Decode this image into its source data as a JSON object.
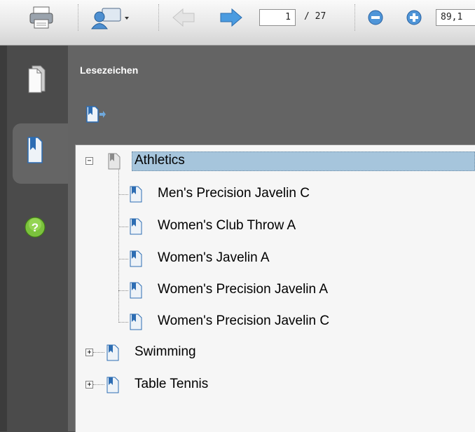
{
  "toolbar": {
    "page_current": "1",
    "page_total": "/ 27",
    "zoom": "89,1",
    "icons": [
      "printer-icon",
      "cloud-collaborate-icon",
      "prev-page-icon",
      "next-page-icon",
      "zoom-out-icon",
      "zoom-in-icon"
    ]
  },
  "rail": {
    "tabs": [
      "pages-icon",
      "bookmarks-icon",
      "help-icon"
    ]
  },
  "panel": {
    "title": "Lesezeichen"
  },
  "bookmarks": {
    "root": {
      "label": "Athletics",
      "expanded": true,
      "selected": true
    },
    "children": [
      {
        "label": "Men's Precision Javelin C"
      },
      {
        "label": "Women's Club Throw A"
      },
      {
        "label": "Women's Javelin A"
      },
      {
        "label": "Women's Precision Javelin A"
      },
      {
        "label": "Women's Precision Javelin C"
      }
    ],
    "siblings": [
      {
        "label": "Swimming",
        "expanded": false
      },
      {
        "label": "Table Tennis",
        "expanded": false
      }
    ]
  },
  "colors": {
    "panel_bg": "#646464",
    "rail_bg": "#4b4b4b",
    "tree_bg": "#f6f6f6",
    "selection": "#a6c5dc"
  }
}
